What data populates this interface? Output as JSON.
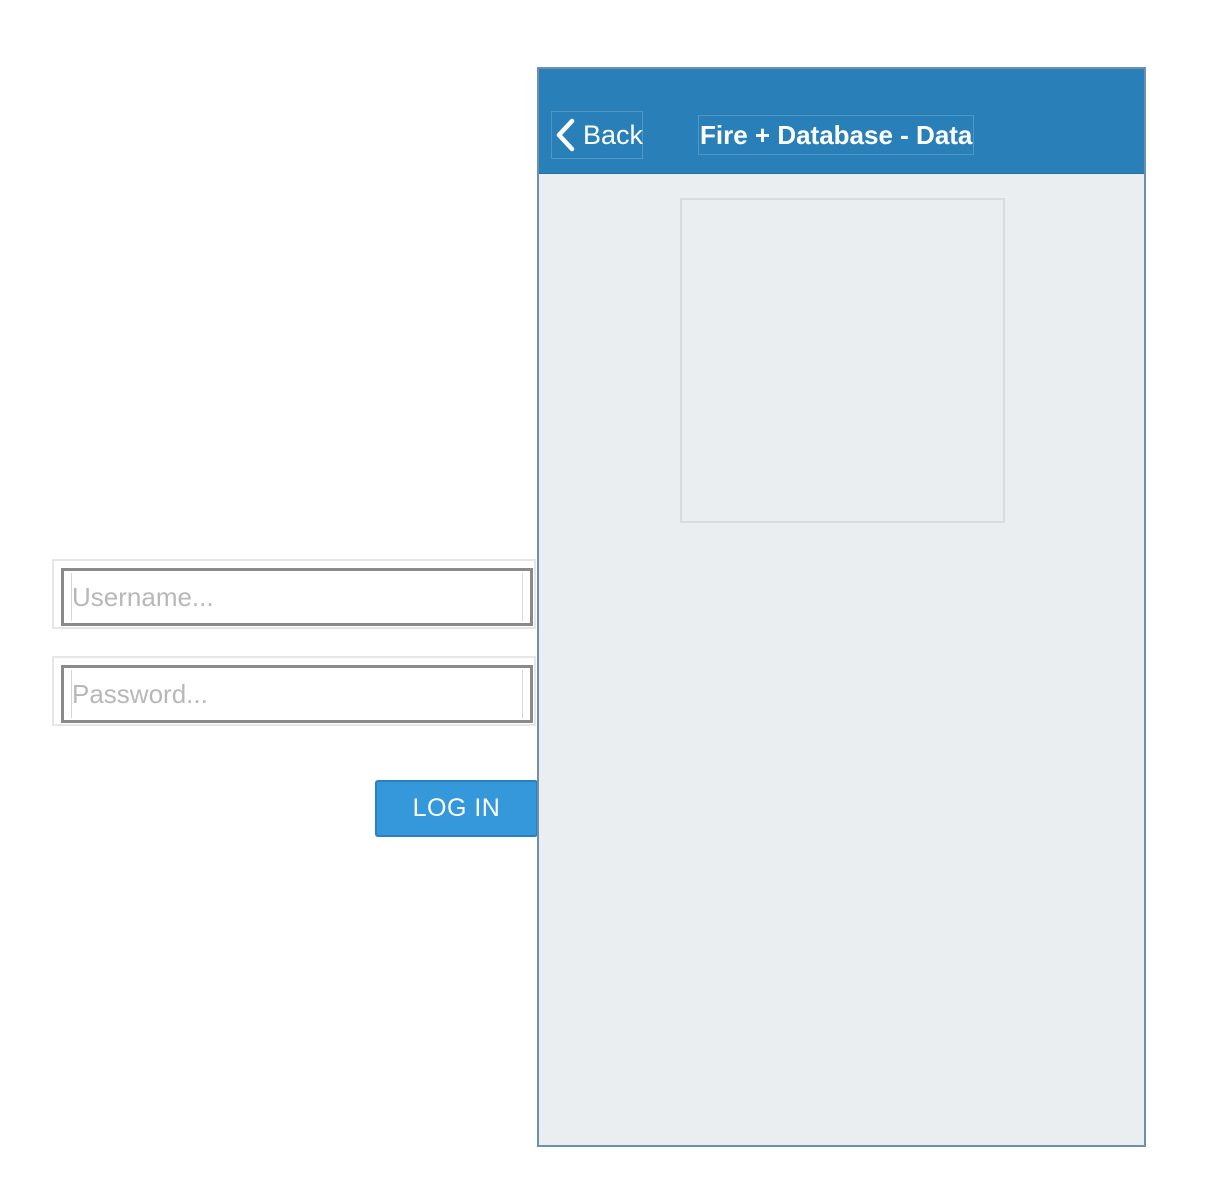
{
  "login_form": {
    "username": {
      "placeholder": "Username...",
      "value": ""
    },
    "password": {
      "placeholder": "Password...",
      "value": ""
    },
    "login_button_label": "LOG IN"
  },
  "detail_screen": {
    "nav_bar": {
      "back_label": "Back",
      "title": "Fire + Database - Data"
    },
    "image": {
      "icon": "image-placeholder"
    }
  },
  "colors": {
    "nav_bar": "#2980b9",
    "button": "#3498db",
    "panel_background": "#ebeef0",
    "placeholder_text": "#b8b8b8"
  }
}
